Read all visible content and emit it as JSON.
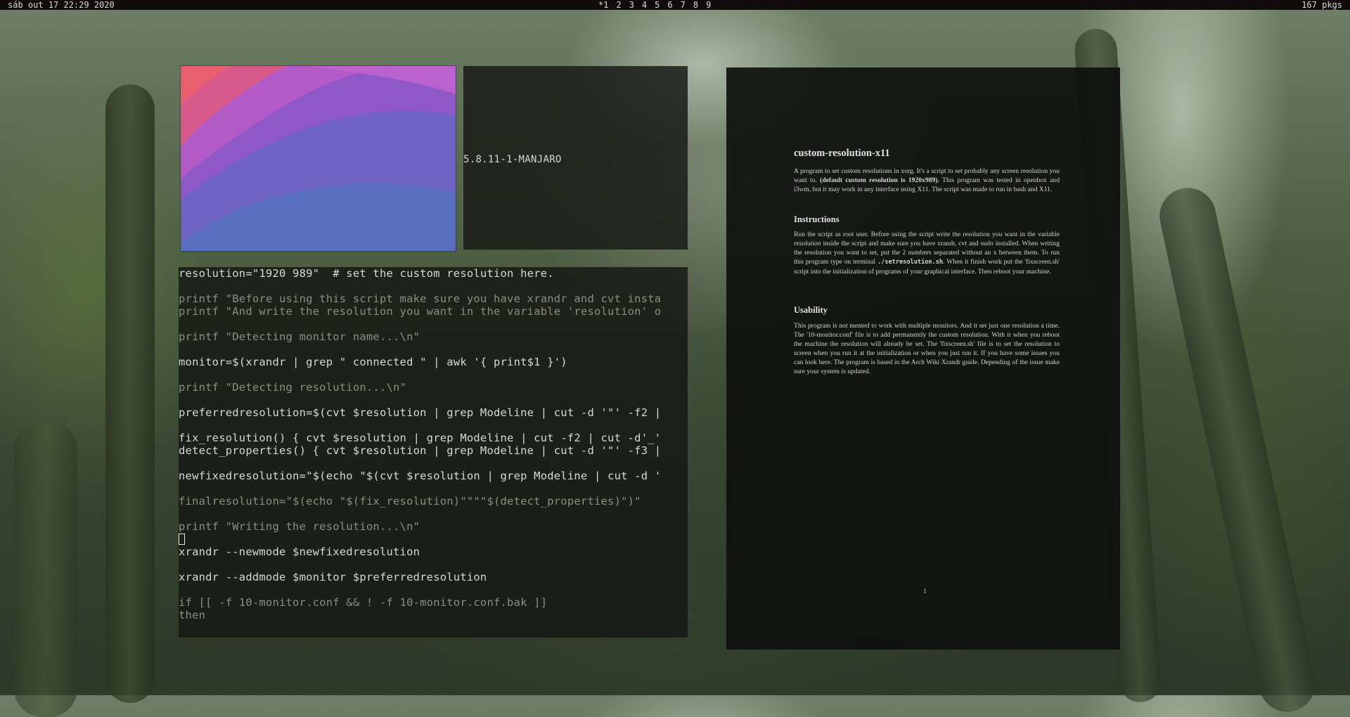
{
  "topbar": {
    "datetime": "sáb out 17 22:29 2020",
    "workspaces": [
      "*1",
      "2",
      "3",
      "4",
      "5",
      "6",
      "7",
      "8",
      "9"
    ],
    "pkgs": "167 pkgs"
  },
  "sysinfo": {
    "kernel": "5.8.11-1-MANJARO"
  },
  "editor": {
    "lines": [
      "resolution=\"1920 989\"  # set the custom resolution here.",
      "printf \"Before using this script make sure you have xrandr and cvt insta",
      "printf \"And write the resolution you want in the variable 'resolution' o",
      "printf \"Detecting monitor name...\\n\"",
      "monitor=$(xrandr | grep \" connected \" | awk '{ print$1 }')",
      "printf \"Detecting resolution...\\n\"",
      "preferredresolution=$(cvt $resolution | grep Modeline | cut -d '\"' -f2 |",
      "fix_resolution() { cvt $resolution | grep Modeline | cut -f2 | cut -d'_'",
      "detect_properties() { cvt $resolution | grep Modeline | cut -d '\"' -f3 |",
      "newfixedresolution=\"$(echo \"$(cvt $resolution | grep Modeline | cut -d '",
      "finalresolution=\"$(echo \"$(fix_resolution)\"\"\"\"$(detect_properties)\")\"",
      "printf \"Writing the resolution...\\n\"",
      "xrandr --newmode $newfixedresolution",
      "xrandr --addmode $monitor $preferredresolution",
      "if [[ -f 10-monitor.conf && ! -f 10-monitor.conf.bak ]]",
      "then"
    ]
  },
  "document": {
    "title": "custom-resolution-x11",
    "intro": "A program to set custom resolutions in xorg. It's a script to set probably any screen resolution you want to.",
    "intro_bold": "(default custom resolution is 1920x989).",
    "intro_rest": "This program was tested in openbox and i3wm, but it may work in any interface using X11. The script was made to run in bash and X11.",
    "instructions_heading": "Instructions",
    "instructions_a": "Run the script as root user. Before using the script write the resolution you want in the variable",
    "instructions_italic": "resolution",
    "instructions_b": "inside the script and make sure you have xrandr, cvt and sudo installed. When writing the resolution you want to set, put the 2 numbers separated without an x between them. To run this program type on terminal",
    "instructions_code": "./setresolution.sh",
    "instructions_c": ". When it finish work put the 'fixscreen.sh' script into the initialization of programs of your graphical interface. Then reboot your machine.",
    "usability_heading": "Usability",
    "usability": "This program is not mented to work with multiple monitors. And it set just one resolution a time. The '10-monitor.conf' file is to add permanently the custom resolution. With it when you reboot the machine the resolution will already be set. The 'fixscreen.sh' file is to set the resolution to screen when you run it at the initialization or when you just run it. If you have some issues you can look here. The program is based in the Arch Wiki Xrandr guide. Depending of the issue make sure your system is updated.",
    "page_number": "1"
  }
}
